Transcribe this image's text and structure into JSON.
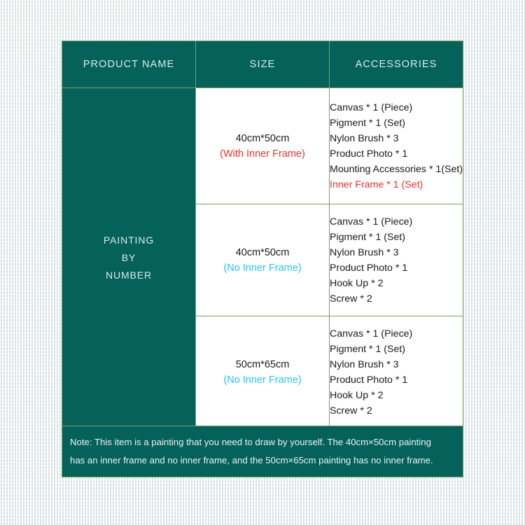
{
  "colors": {
    "teal": "#04625b",
    "border_green": "#7f9e5f",
    "accent_red": "#e8332e",
    "accent_cyan": "#2bc4ee",
    "header_text": "#d9ecec",
    "background": "#e9efed"
  },
  "table": {
    "headers": [
      "PRODUCT NAME",
      "SIZE",
      "ACCESSORIES"
    ],
    "product_name_lines": [
      "PAINTING",
      "BY",
      "NUMBER"
    ],
    "rows": [
      {
        "size": "40cm*50cm",
        "size_note": "(With Inner Frame)",
        "size_note_color": "red",
        "accessories": [
          {
            "text": "Canvas * 1 (Piece)",
            "color": "black"
          },
          {
            "text": "Pigment * 1 (Set)",
            "color": "black"
          },
          {
            "text": "Nylon Brush * 3",
            "color": "black"
          },
          {
            "text": "Product Photo * 1",
            "color": "black"
          },
          {
            "text": "Mounting Accessories * 1(Set)",
            "color": "black"
          },
          {
            "text": "Inner Frame * 1 (Set)",
            "color": "red"
          }
        ]
      },
      {
        "size": "40cm*50cm",
        "size_note": "(No Inner Frame)",
        "size_note_color": "cyan",
        "accessories": [
          {
            "text": "Canvas * 1 (Piece)",
            "color": "black"
          },
          {
            "text": "Pigment * 1 (Set)",
            "color": "black"
          },
          {
            "text": "Nylon Brush * 3",
            "color": "black"
          },
          {
            "text": "Product Photo * 1",
            "color": "black"
          },
          {
            "text": "Hook Up * 2",
            "color": "black"
          },
          {
            "text": "Screw * 2",
            "color": "black"
          }
        ]
      },
      {
        "size": "50cm*65cm",
        "size_note": "(No Inner Frame)",
        "size_note_color": "cyan",
        "accessories": [
          {
            "text": "Canvas * 1 (Piece)",
            "color": "black"
          },
          {
            "text": "Pigment * 1 (Set)",
            "color": "black"
          },
          {
            "text": "Nylon Brush * 3",
            "color": "black"
          },
          {
            "text": "Product Photo * 1",
            "color": "black"
          },
          {
            "text": "Hook Up * 2",
            "color": "black"
          },
          {
            "text": "Screw * 2",
            "color": "black"
          }
        ]
      }
    ]
  },
  "note": {
    "line1": "Note: This item is a painting that you need to draw by yourself. The 40cm×50cm painting",
    "line2": "has an inner frame and no inner frame, and the 50cm×65cm painting has no inner frame."
  }
}
